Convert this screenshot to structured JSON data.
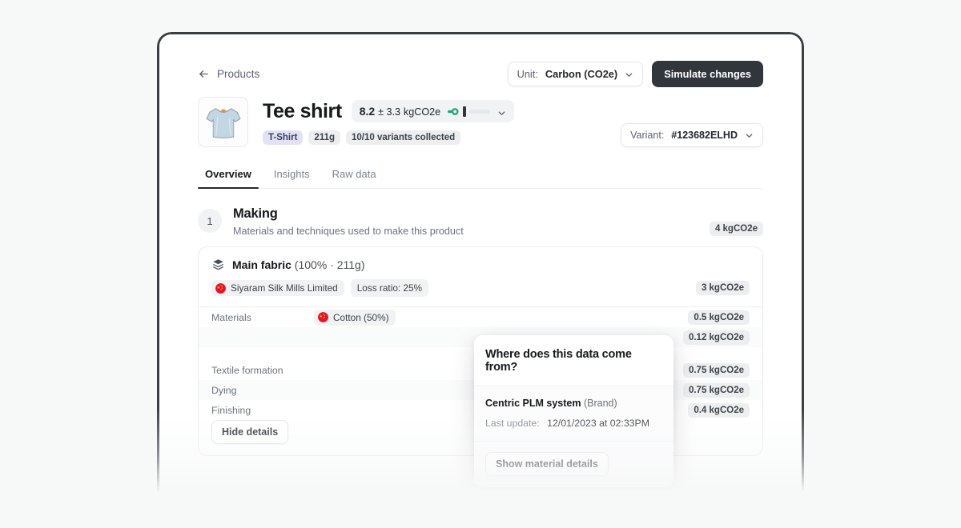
{
  "topbar": {
    "back_label": "Products",
    "back_icon": "arrow-left-icon",
    "unit_prefix": "Unit:",
    "unit_value": "Carbon (CO2e)",
    "simulate_label": "Simulate changes"
  },
  "product": {
    "title": "Tee shirt",
    "impact_value": "8.2",
    "impact_pm": "± 3.3",
    "impact_unit": "kgCO2e",
    "badges": [
      {
        "label": "T-Shirt",
        "style": "lilac"
      },
      {
        "label": "211g",
        "style": "grey"
      },
      {
        "label": "10/10 variants collected",
        "style": "grey"
      }
    ],
    "variant_prefix": "Variant:",
    "variant_value": "#123682ELHD",
    "thumbnail": "tee-shirt-image"
  },
  "tabs": [
    {
      "label": "Overview",
      "active": true
    },
    {
      "label": "Insights",
      "active": false
    },
    {
      "label": "Raw data",
      "active": false
    }
  ],
  "stage": {
    "number": "1",
    "title": "Making",
    "subtitle": "Materials and techniques used to make this product",
    "value": "4 kgCO2e"
  },
  "fabric": {
    "name": "Main fabric",
    "details": "(100% · 211g)",
    "supplier": "Siyaram Silk Mills Limited",
    "supplier_flag": "china-flag-icon",
    "loss_ratio": "Loss ratio: 25%",
    "value": "3 kgCO2e",
    "hide_details_label": "Hide details",
    "rows": [
      {
        "label": "Materials",
        "chip": "Cotton (50%)",
        "chip_flag": "china-flag-icon",
        "value": "0.5 kgCO2e",
        "band": false
      },
      {
        "label": "",
        "chip": "",
        "chip_flag": "",
        "value": "0.12 kgCO2e",
        "band": true
      },
      {
        "label": "Textile formation",
        "chip": "",
        "chip_flag": "",
        "value": "0.75 kgCO2e",
        "band": false
      },
      {
        "label": "Dying",
        "chip": "",
        "chip_flag": "",
        "value": "0.75 kgCO2e",
        "band": true
      },
      {
        "label": "Finishing",
        "chip": "",
        "chip_flag": "",
        "value": "0.4 kgCO2e",
        "band": false
      }
    ]
  },
  "popover": {
    "title": "Where does this data come from?",
    "source_name": "Centric PLM system",
    "source_type": "(Brand)",
    "update_label": "Last update:",
    "update_value": "12/01/2023 at 02:33PM",
    "action_label": "Show material details"
  },
  "colors": {
    "accent_dark": "#31353c",
    "gauge_green": "#19a974",
    "badge_lilac": "#e2e2f5",
    "flag_red": "#e8112d"
  }
}
